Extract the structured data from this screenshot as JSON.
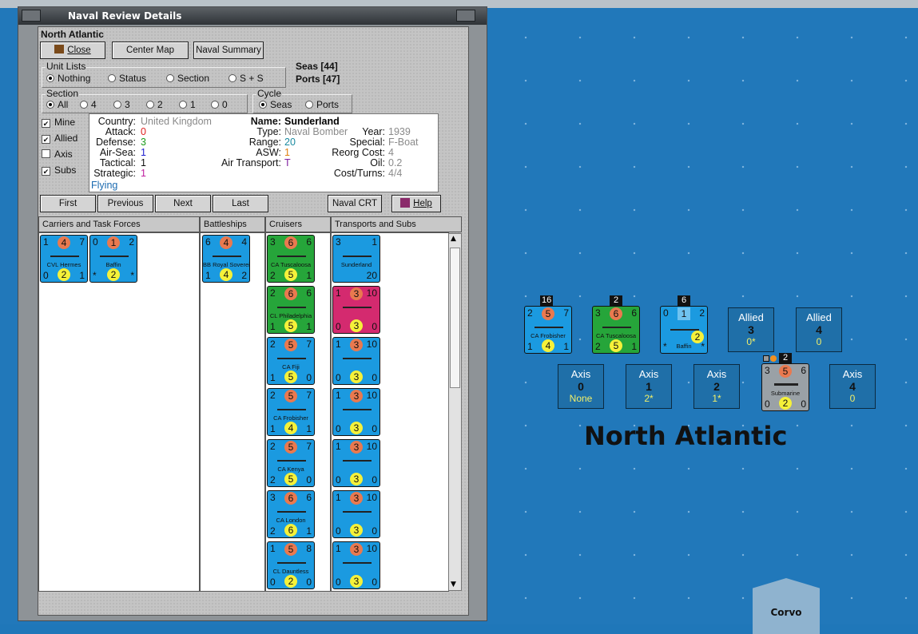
{
  "window": {
    "title": "Naval Review Details",
    "area": "North Atlantic"
  },
  "toolbar": {
    "close": "Close",
    "center_map": "Center Map",
    "naval_summary": "Naval Summary"
  },
  "counts": {
    "seas": "Seas [44]",
    "ports": "Ports [47]"
  },
  "unit_lists": {
    "label": "Unit Lists",
    "options": [
      "Nothing",
      "Status",
      "Section",
      "S + S"
    ],
    "selected": "Nothing"
  },
  "section": {
    "label": "Section",
    "options": [
      "All",
      "4",
      "3",
      "2",
      "1",
      "0"
    ],
    "selected": "All"
  },
  "cycle": {
    "label": "Cycle",
    "options": [
      "Seas",
      "Ports"
    ],
    "selected": "Seas"
  },
  "filters": [
    {
      "label": "Mine",
      "checked": true
    },
    {
      "label": "Allied",
      "checked": true
    },
    {
      "label": "Axis",
      "checked": false
    },
    {
      "label": "Subs",
      "checked": true
    }
  ],
  "unit": {
    "country_label": "Country:",
    "country": "United Kingdom",
    "attack_label": "Attack:",
    "attack": "0",
    "defense_label": "Defense:",
    "defense": "3",
    "airsea_label": "Air-Sea:",
    "airsea": "1",
    "tactical_label": "Tactical:",
    "tactical": "1",
    "strategic_label": "Strategic:",
    "strategic": "1",
    "status": "Flying",
    "name_label": "Name:",
    "name": "Sunderland",
    "type_label": "Type:",
    "type": "Naval Bomber",
    "year_label": "Year:",
    "year": "1939",
    "range_label": "Range:",
    "range": "20",
    "special_label": "Special:",
    "special": "F-Boat",
    "asw_label": "ASW:",
    "asw": "1",
    "reorg_label": "Reorg Cost:",
    "reorg": "4",
    "airtrans_label": "Air Transport:",
    "airtrans": "T",
    "oil_label": "Oil:",
    "oil": "0.2",
    "cost_label": "Cost/Turns:",
    "cost": "4/4"
  },
  "nav": {
    "first": "First",
    "previous": "Previous",
    "next": "Next",
    "last": "Last",
    "naval_crt": "Naval CRT",
    "help": "Help"
  },
  "columns": [
    "Carriers and Task Forces",
    "Battleships",
    "Cruisers",
    "Transports and Subs"
  ],
  "colors": {
    "blue": "#1b9ae0",
    "green": "#26a53a",
    "magenta": "#d42a6f",
    "grey": "#9aa1a6"
  },
  "carriers": [
    {
      "tl": "1",
      "tc": "4",
      "tr": "7",
      "bl": "0",
      "bc": "2",
      "br": "1",
      "name": "CVL Hermes",
      "color": "blue"
    },
    {
      "tl": "0",
      "tc": "1",
      "tr": "2",
      "bl": "*",
      "bc": "2",
      "br": "*",
      "name": "Baffin",
      "color": "blue"
    }
  ],
  "battleships": [
    {
      "tl": "6",
      "tc": "4",
      "tr": "4",
      "bl": "1",
      "bc": "4",
      "br": "2",
      "name": "BB Royal Sovereign",
      "color": "blue"
    }
  ],
  "cruisers": [
    {
      "tl": "3",
      "tc": "6",
      "tr": "6",
      "bl": "2",
      "bc": "5",
      "br": "1",
      "name": "CA Tuscaloosa",
      "color": "green"
    },
    {
      "tl": "2",
      "tc": "6",
      "tr": "6",
      "bl": "1",
      "bc": "5",
      "br": "1",
      "name": "CL Philadelphia",
      "color": "green"
    },
    {
      "tl": "2",
      "tc": "5",
      "tr": "7",
      "bl": "1",
      "bc": "5",
      "br": "0",
      "name": "CA Fiji",
      "color": "blue"
    },
    {
      "tl": "2",
      "tc": "5",
      "tr": "7",
      "bl": "1",
      "bc": "4",
      "br": "1",
      "name": "CA Frobisher",
      "color": "blue"
    },
    {
      "tl": "2",
      "tc": "5",
      "tr": "7",
      "bl": "2",
      "bc": "5",
      "br": "0",
      "name": "CA Kenya",
      "color": "blue"
    },
    {
      "tl": "3",
      "tc": "6",
      "tr": "6",
      "bl": "2",
      "bc": "6",
      "br": "1",
      "name": "CA London",
      "color": "blue"
    },
    {
      "tl": "1",
      "tc": "5",
      "tr": "8",
      "bl": "0",
      "bc": "2",
      "br": "0",
      "name": "CL Dauntless",
      "color": "blue"
    }
  ],
  "transports": [
    {
      "tl": "3",
      "tc": "",
      "tr": "1",
      "bl": "",
      "bc": "",
      "br": "20",
      "name": "Sunderland",
      "color": "blue"
    },
    {
      "tl": "1",
      "tc": "3",
      "tr": "10",
      "bl": "0",
      "bc": "3",
      "br": "0",
      "name": "",
      "color": "magenta"
    },
    {
      "tl": "1",
      "tc": "3",
      "tr": "10",
      "bl": "0",
      "bc": "3",
      "br": "0",
      "name": "",
      "color": "blue"
    },
    {
      "tl": "1",
      "tc": "3",
      "tr": "10",
      "bl": "0",
      "bc": "3",
      "br": "0",
      "name": "",
      "color": "blue"
    },
    {
      "tl": "1",
      "tc": "3",
      "tr": "10",
      "bl": "0",
      "bc": "3",
      "br": "0",
      "name": "",
      "color": "blue"
    },
    {
      "tl": "1",
      "tc": "3",
      "tr": "10",
      "bl": "0",
      "bc": "3",
      "br": "0",
      "name": "",
      "color": "blue"
    },
    {
      "tl": "1",
      "tc": "3",
      "tr": "10",
      "bl": "0",
      "bc": "3",
      "br": "0",
      "name": "",
      "color": "blue"
    }
  ],
  "map": {
    "title": "North Atlantic",
    "corvo": "Corvo",
    "stacks": [
      {
        "count": "16",
        "tl": "2",
        "tc": "5",
        "tr": "7",
        "bl": "1",
        "bc": "4",
        "br": "1",
        "name": "CA Frobisher",
        "color": "blue"
      },
      {
        "count": "2",
        "tl": "3",
        "tc": "6",
        "tr": "6",
        "bl": "2",
        "bc": "5",
        "br": "1",
        "name": "CA Tuscaloosa",
        "color": "green"
      },
      {
        "count": "6",
        "tl": "0",
        "tc": "1",
        "tr": "2",
        "bl": "*",
        "bc": "2",
        "br": "*",
        "name": "Baffin",
        "color": "blue"
      },
      {
        "count": "2",
        "tl": "3",
        "tc": "5",
        "tr": "6",
        "bl": "0",
        "bc": "2",
        "br": "0",
        "name": "Submarine",
        "color": "grey"
      }
    ],
    "allied_boxes": [
      {
        "side": "Allied",
        "num": "3",
        "val": "0*"
      },
      {
        "side": "Allied",
        "num": "4",
        "val": "0"
      }
    ],
    "axis_boxes": [
      {
        "side": "Axis",
        "num": "0",
        "val": "None"
      },
      {
        "side": "Axis",
        "num": "1",
        "val": "2*"
      },
      {
        "side": "Axis",
        "num": "2",
        "val": "1*"
      },
      {
        "side": "Axis",
        "num": "4",
        "val": "0"
      }
    ]
  }
}
